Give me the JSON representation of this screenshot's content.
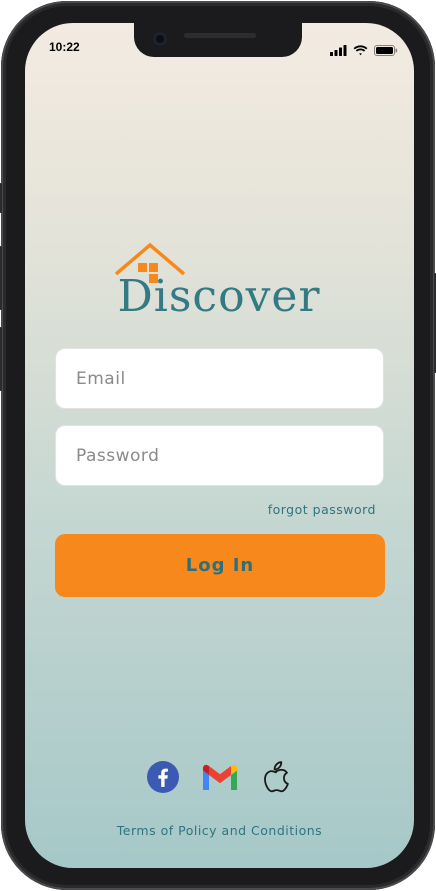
{
  "status_bar": {
    "time": "10:22",
    "icons": [
      "signal-icon",
      "wifi-icon",
      "battery-icon"
    ]
  },
  "logo": {
    "text": "Discover",
    "icon": "house-icon",
    "brand_color": "#337a84",
    "accent_color": "#f7891c"
  },
  "login_form": {
    "email_placeholder": "Email",
    "email_value": "",
    "password_placeholder": "Password",
    "password_value": "",
    "forgot_password_label": "forgot password",
    "login_button_label": "Log In"
  },
  "social_login": {
    "providers": [
      "facebook-icon",
      "gmail-icon",
      "apple-icon"
    ]
  },
  "footer": {
    "terms_label": "Terms of Policy and Conditions"
  }
}
